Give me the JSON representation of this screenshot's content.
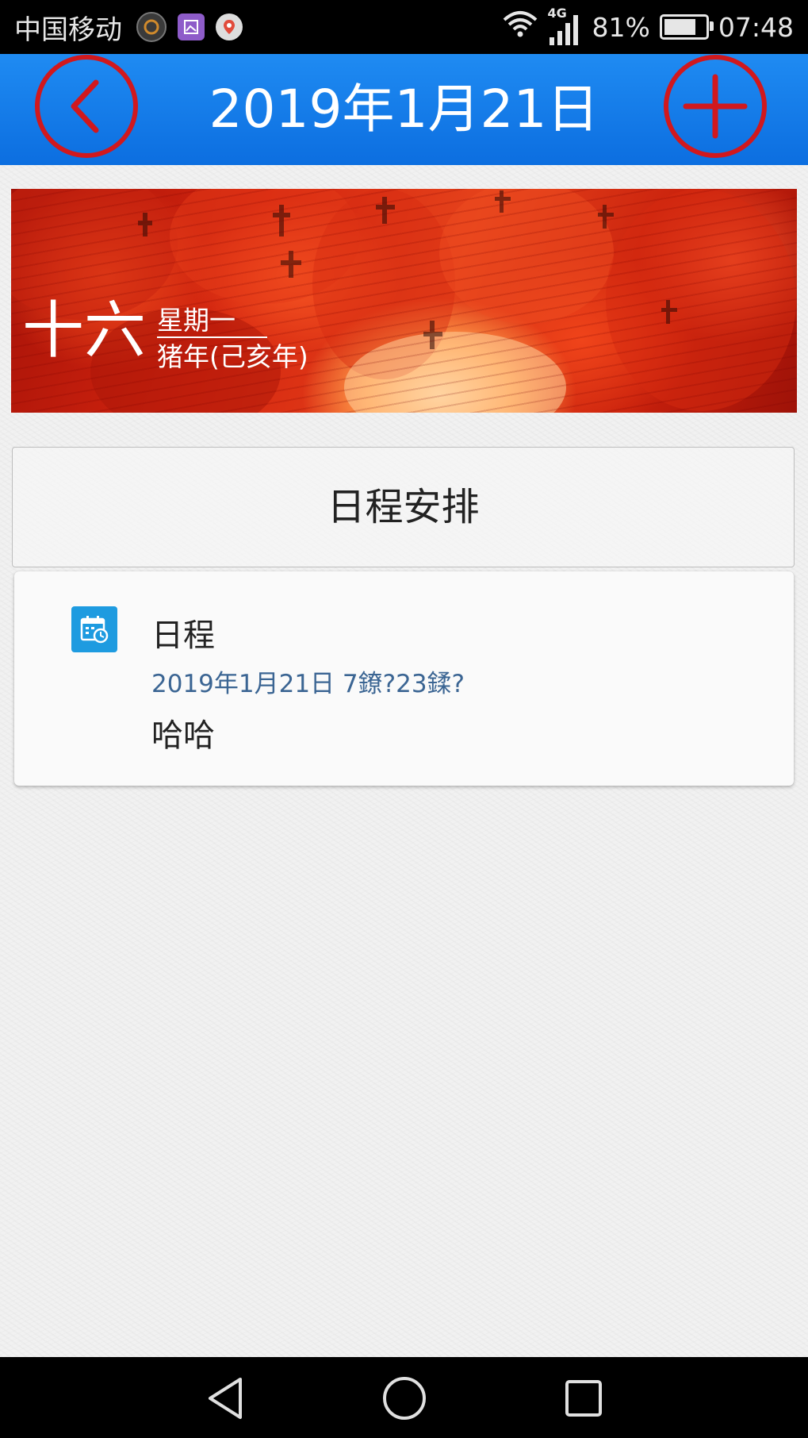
{
  "status_bar": {
    "carrier": "中国移动",
    "network": "4G",
    "battery_percent": "81%",
    "battery_level": 0.81,
    "time": "07:48",
    "icons": [
      "notification-app-icon",
      "gallery-icon",
      "location-pin-icon",
      "wifi-icon",
      "signal-icon",
      "battery-icon"
    ]
  },
  "header": {
    "title": "2019年1月21日",
    "back_icon": "chevron-left-circle-icon",
    "add_icon": "plus-circle-icon",
    "accent_color": "#d1181d",
    "background_color": "#0c6ee0"
  },
  "banner": {
    "lunar_day": "十六",
    "weekday": "星期一",
    "zodiac_year": "猪年(己亥年)"
  },
  "section": {
    "title": "日程安排"
  },
  "schedule_items": [
    {
      "icon": "calendar-clock-icon",
      "title": "日程",
      "datetime": "2019年1月21日 7鐐?23鍒?",
      "note": "哈哈"
    }
  ],
  "nav_bar": {
    "icons": [
      "back-triangle-icon",
      "home-circle-icon",
      "recent-square-icon"
    ]
  }
}
